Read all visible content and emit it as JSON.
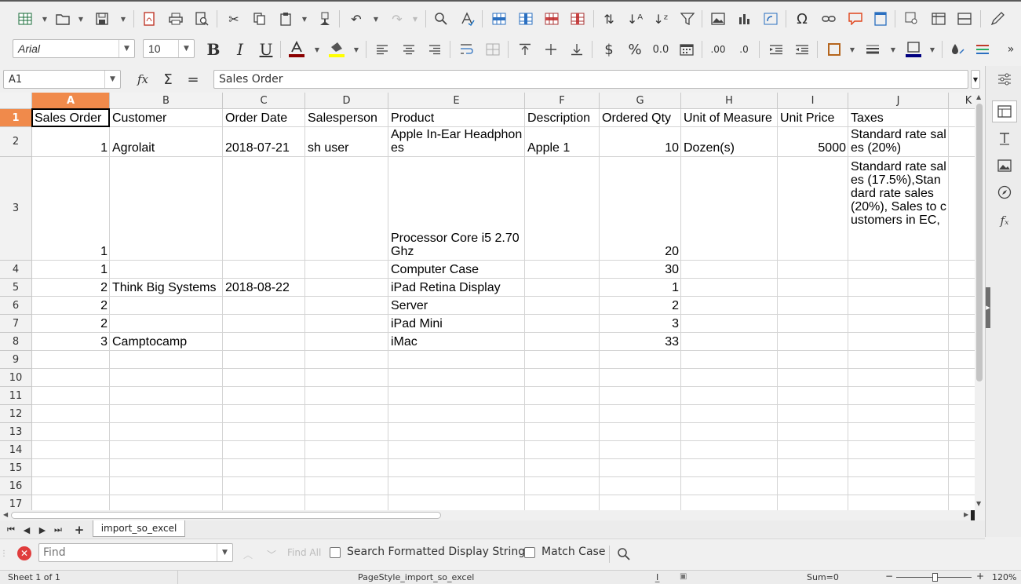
{
  "font_bar": {
    "font_name": "Arial",
    "font_size": "10"
  },
  "formula_bar": {
    "name_box": "A1",
    "fx_icon": "fx",
    "sigma_icon": "Σ",
    "equals_icon": "=",
    "content": "Sales Order"
  },
  "columns": [
    "A",
    "B",
    "C",
    "D",
    "E",
    "F",
    "G",
    "H",
    "I",
    "J",
    "K"
  ],
  "rows": [
    "1",
    "2",
    "3",
    "4",
    "5",
    "6",
    "7",
    "8",
    "9",
    "10",
    "11",
    "12",
    "13",
    "14",
    "15",
    "16",
    "17"
  ],
  "cells": {
    "r1": [
      "Sales Order",
      "Customer",
      "Order Date",
      "Salesperson",
      "Product",
      "Description",
      "Ordered Qty",
      "Unit of Measure",
      "Unit Price",
      "Taxes"
    ],
    "r2": {
      "a": "1",
      "b": "Agrolait",
      "c": "2018-07-21",
      "d": "sh user",
      "e": "Apple In-Ear Headphones",
      "f": "Apple 1",
      "g": "10",
      "h": "Dozen(s)",
      "i": "5000",
      "j": "Standard rate sales (20%)"
    },
    "r3": {
      "a": "1",
      "e": "Processor Core i5 2.70 Ghz",
      "g": "20",
      "j": "Standard rate sales (17.5%),Standard rate sales (20%),   Sales to customers in EC,"
    },
    "r4": {
      "a": "1",
      "e": "Computer Case",
      "g": "30"
    },
    "r5": {
      "a": "2",
      "b": "Think Big Systems",
      "c": "2018-08-22",
      "e": "iPad Retina Display",
      "g": "1"
    },
    "r6": {
      "a": "2",
      "e": "Server",
      "g": "2"
    },
    "r7": {
      "a": "2",
      "e": "iPad Mini",
      "g": "3"
    },
    "r8": {
      "a": "3",
      "b": "Camptocamp",
      "e": "iMac",
      "g": "33"
    }
  },
  "sheet_tabs": {
    "active": "import_so_excel"
  },
  "find_bar": {
    "placeholder": "Find",
    "find_all": "Find All",
    "search_formatted": "Search Formatted Display String",
    "match_case": "Match Case"
  },
  "status": {
    "sheet": "Sheet 1 of 1",
    "page_style": "PageStyle_import_so_excel",
    "sum": "Sum=0",
    "zoom": "120%"
  },
  "colors": {
    "selected_header": "#f08a4b",
    "cursor_border": "#000000"
  }
}
